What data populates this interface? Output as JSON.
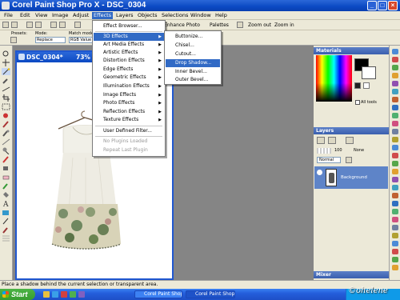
{
  "window": {
    "title": "Corel Paint Shop Pro X - DSC_0304"
  },
  "menubar": [
    "File",
    "Edit",
    "View",
    "Image",
    "Adjust",
    "Effects",
    "Layers",
    "Objects",
    "Selections",
    "Window",
    "Help"
  ],
  "toolbar": {
    "enhance_photo": "Enhance Photo",
    "palettes": "Palettes",
    "zoom_out": "Zoom out",
    "zoom_in": "Zoom in"
  },
  "presets": {
    "presets_label": "Presets:",
    "mode_label": "Mode:",
    "mode_value": "Replace",
    "match_label": "Match mode:",
    "match_value": "RGB Value"
  },
  "document": {
    "title": "DSC_0304*",
    "zoom": "73%"
  },
  "effects_menu": {
    "items": [
      {
        "label": "Effect Browser...",
        "submenu": false,
        "disabled": false
      },
      {
        "label": "3D Effects",
        "submenu": true,
        "disabled": false,
        "highlighted": true
      },
      {
        "label": "Art Media Effects",
        "submenu": true,
        "disabled": false
      },
      {
        "label": "Artistic Effects",
        "submenu": true,
        "disabled": false
      },
      {
        "label": "Distortion Effects",
        "submenu": true,
        "disabled": false
      },
      {
        "label": "Edge Effects",
        "submenu": true,
        "disabled": false
      },
      {
        "label": "Geometric Effects",
        "submenu": true,
        "disabled": false
      },
      {
        "label": "Illumination Effects",
        "submenu": true,
        "disabled": false
      },
      {
        "label": "Image Effects",
        "submenu": true,
        "disabled": false
      },
      {
        "label": "Photo Effects",
        "submenu": true,
        "disabled": false
      },
      {
        "label": "Reflection Effects",
        "submenu": true,
        "disabled": false
      },
      {
        "label": "Texture Effects",
        "submenu": true,
        "disabled": false
      },
      {
        "label": "User Defined Filter...",
        "submenu": false,
        "disabled": false
      },
      {
        "label": "No Plugins Loaded",
        "submenu": false,
        "disabled": true
      },
      {
        "label": "Repeat Last Plugin",
        "submenu": false,
        "disabled": true
      }
    ]
  },
  "submenu_3d": {
    "items": [
      {
        "label": "Buttonize...",
        "highlighted": false
      },
      {
        "label": "Chisel...",
        "highlighted": false
      },
      {
        "label": "Cutout...",
        "highlighted": false
      },
      {
        "label": "Drop Shadow...",
        "highlighted": true
      },
      {
        "label": "Inner Bevel...",
        "highlighted": false
      },
      {
        "label": "Outer Bevel...",
        "highlighted": false
      }
    ]
  },
  "materials": {
    "title": "Materials",
    "all_tools": "All tools"
  },
  "layers": {
    "title": "Layers",
    "opacity": "100",
    "blend_mode": "Normal",
    "none_label": "None",
    "layer_name": "Background"
  },
  "mixer": {
    "title": "Mixer"
  },
  "statusbar": {
    "text": "Place a shadow behind the current selection or transparent area."
  },
  "taskbar": {
    "start": "Start",
    "task_1": "Corel Paint Shop ...",
    "task_2": "Corel Paint Shop ..."
  },
  "watermark": "©ohelene",
  "colors": {
    "titlebar": "#0b49c3",
    "menu_highlight": "#316ac5",
    "taskbar": "#245edb",
    "start": "#379d2f"
  }
}
